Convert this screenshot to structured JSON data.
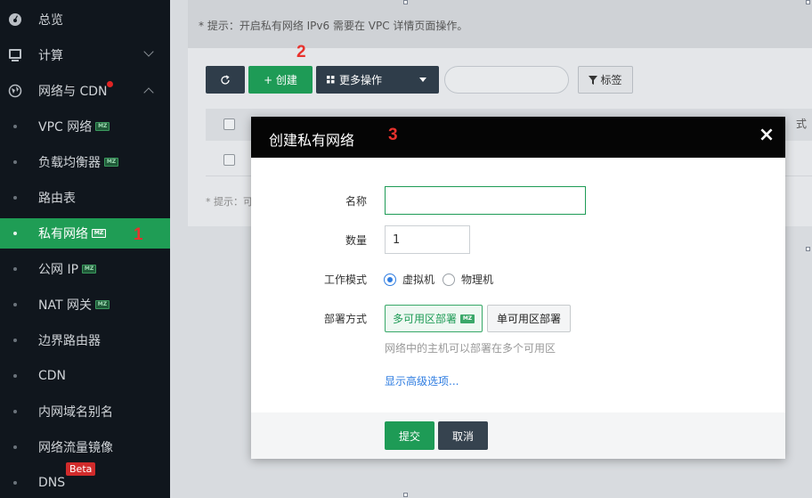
{
  "sidebar": {
    "items": [
      {
        "label": "总览"
      },
      {
        "label": "计算"
      },
      {
        "label": "网络与 CDN"
      },
      {
        "label": "VPC 网络",
        "badge": "MZ"
      },
      {
        "label": "负载均衡器",
        "badge": "MZ"
      },
      {
        "label": "路由表"
      },
      {
        "label": "私有网络",
        "badge": "MZ"
      },
      {
        "label": "公网 IP",
        "badge": "MZ"
      },
      {
        "label": "NAT 网关",
        "badge": "MZ"
      },
      {
        "label": "边界路由器"
      },
      {
        "label": "CDN"
      },
      {
        "label": "内网域名别名"
      },
      {
        "label": "网络流量镜像"
      },
      {
        "label": "DNS",
        "tag": "Beta"
      }
    ],
    "active_color": "#1f9d55"
  },
  "annotations": {
    "step1": "1",
    "step2": "2",
    "step3": "3"
  },
  "main": {
    "tip": "* 提示：开启私有网络 IPv6 需要在 VPC 详情页面操作。",
    "toolbar": {
      "create_label": "+ 创建",
      "more_label": "更多操作",
      "tag_label": "标签"
    },
    "panel_tip": "* 提示：可",
    "edge_text": "式"
  },
  "modal": {
    "title": "创建私有网络",
    "close": "×",
    "fields": {
      "name_label": "名称",
      "name_value": "",
      "count_label": "数量",
      "count_value": "1",
      "mode_label": "工作模式",
      "mode_options": [
        "虚拟机",
        "物理机"
      ],
      "mode_selected": "虚拟机",
      "deploy_label": "部署方式",
      "deploy_multi": "多可用区部署",
      "deploy_multi_badge": "MZ",
      "deploy_single": "单可用区部署",
      "deploy_hint": "网络中的主机可以部署在多个可用区",
      "advanced_link": "显示高级选项..."
    },
    "submit_label": "提交",
    "cancel_label": "取消"
  },
  "colors": {
    "primary_green": "#1e9b56",
    "dark_button": "#2f3d4a",
    "link_blue": "#2f7de1",
    "step_red": "#e8322d"
  }
}
